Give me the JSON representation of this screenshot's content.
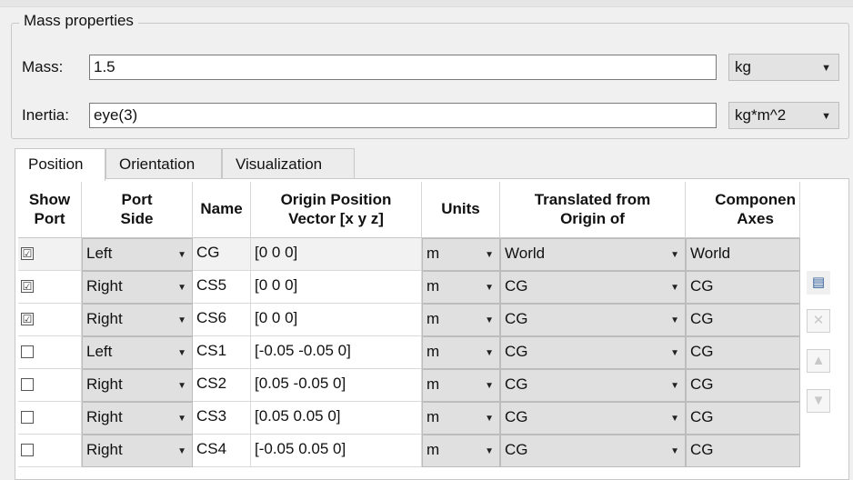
{
  "mass_properties": {
    "title": "Mass properties",
    "mass": {
      "label": "Mass:",
      "value": "1.5",
      "units": "kg"
    },
    "inertia": {
      "label": "Inertia:",
      "value": "eye(3)",
      "units": "kg*m^2"
    }
  },
  "tabs": [
    {
      "label": "Position",
      "active": true
    },
    {
      "label": "Orientation",
      "active": false
    },
    {
      "label": "Visualization",
      "active": false
    }
  ],
  "table": {
    "headers": {
      "show_port": "Show\nPort",
      "port_side": "Port\nSide",
      "name": "Name",
      "origin": "Origin Position\nVector [x y z]",
      "units": "Units",
      "translated": "Translated from\nOrigin of",
      "component": "Componen\nAxes"
    },
    "rows": [
      {
        "show": "☑",
        "side": "Left",
        "name": "CG",
        "vector": "[0 0 0]",
        "units": "m",
        "translated": "World",
        "axes": "World"
      },
      {
        "show": "☑",
        "side": "Right",
        "name": "CS5",
        "vector": "[0 0 0]",
        "units": "m",
        "translated": "CG",
        "axes": "CG"
      },
      {
        "show": "☑",
        "side": "Right",
        "name": "CS6",
        "vector": "[0 0 0]",
        "units": "m",
        "translated": "CG",
        "axes": "CG"
      },
      {
        "show": "",
        "side": "Left",
        "name": "CS1",
        "vector": "[-0.05 -0.05 0]",
        "units": "m",
        "translated": "CG",
        "axes": "CG"
      },
      {
        "show": "",
        "side": "Right",
        "name": "CS2",
        "vector": "[0.05 -0.05 0]",
        "units": "m",
        "translated": "CG",
        "axes": "CG"
      },
      {
        "show": "",
        "side": "Right",
        "name": "CS3",
        "vector": "[0.05 0.05 0]",
        "units": "m",
        "translated": "CG",
        "axes": "CG"
      },
      {
        "show": "",
        "side": "Right",
        "name": "CS4",
        "vector": "[-0.05 0.05 0]",
        "units": "m",
        "translated": "CG",
        "axes": "CG"
      }
    ]
  },
  "side_buttons": [
    {
      "icon": "add-frame-icon",
      "glyph": "▤",
      "enabled": true
    },
    {
      "icon": "delete-icon",
      "glyph": "✕",
      "enabled": false
    },
    {
      "icon": "move-up-icon",
      "glyph": "▲",
      "enabled": false
    },
    {
      "icon": "move-down-icon",
      "glyph": "▼",
      "enabled": false
    }
  ]
}
